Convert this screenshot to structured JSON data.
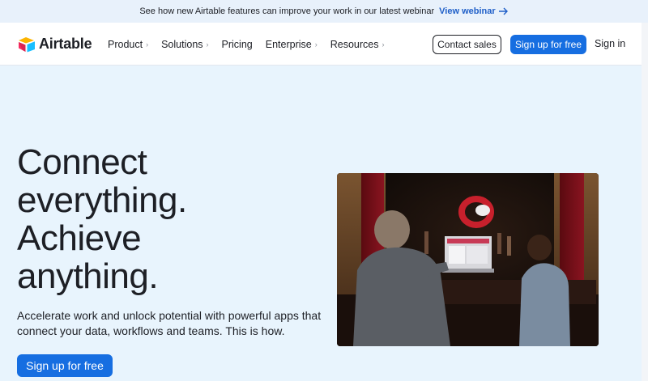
{
  "banner": {
    "text": "See how new Airtable features can improve your work in our latest webinar",
    "link_label": "View webinar"
  },
  "nav": {
    "brand": "Airtable",
    "menu": [
      {
        "label": "Product",
        "has_dropdown": true
      },
      {
        "label": "Solutions",
        "has_dropdown": true
      },
      {
        "label": "Pricing",
        "has_dropdown": false
      },
      {
        "label": "Enterprise",
        "has_dropdown": true
      },
      {
        "label": "Resources",
        "has_dropdown": true
      }
    ],
    "contact_sales": "Contact sales",
    "signup": "Sign up for free",
    "signin": "Sign in"
  },
  "hero": {
    "title_lines": [
      "Connect",
      "everything.",
      "Achieve",
      "anything."
    ],
    "subtitle": "Accelerate work and unlock potential with powerful apps that connect your data, workflows and teams. This is how.",
    "cta": "Sign up for free"
  },
  "colors": {
    "page_bg": "#e8f4fd",
    "primary": "#166ee1",
    "text": "#1d1f25",
    "link": "#1f5fc8"
  }
}
